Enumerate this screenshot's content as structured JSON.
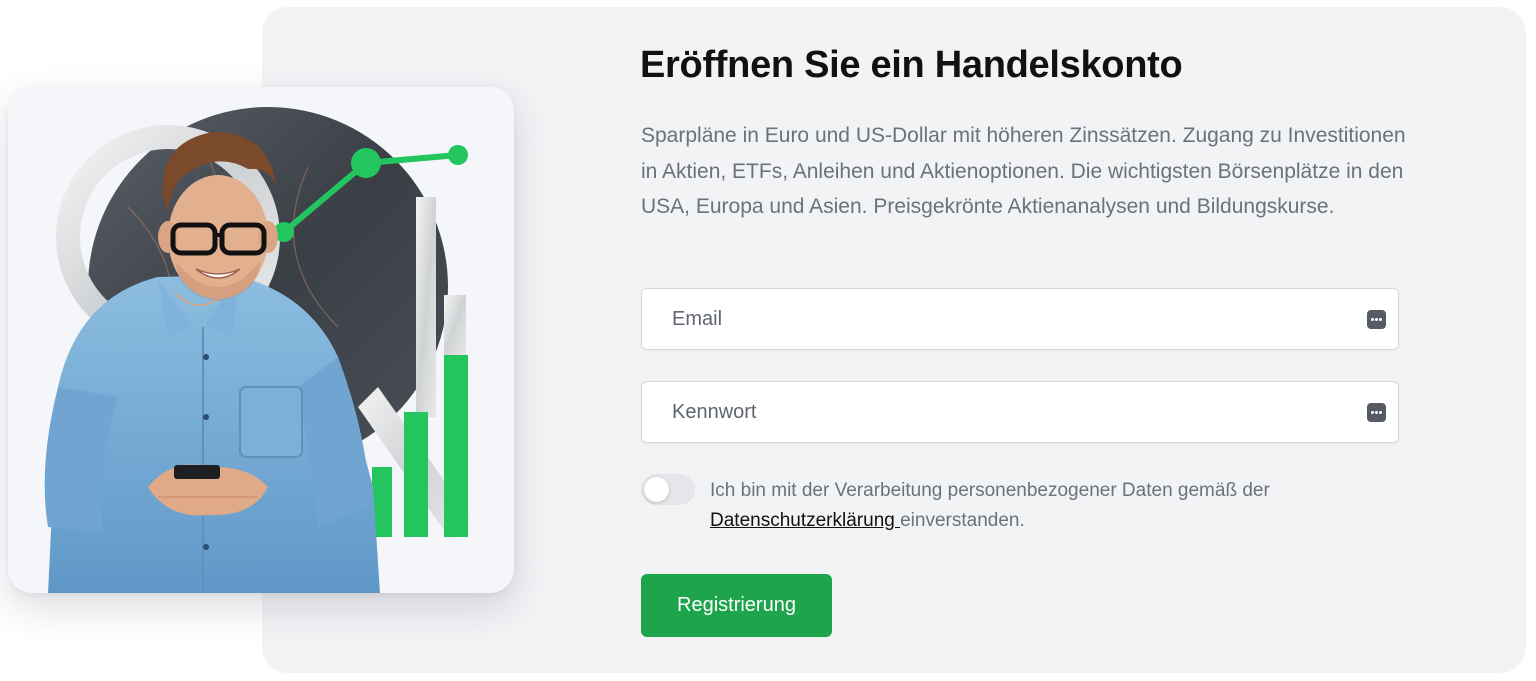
{
  "signup": {
    "title": "Eröffnen Sie ein Handelskonto",
    "description": "Sparpläne in Euro und US-Dollar mit höheren Zinssätzen. Zugang zu Investitionen in Aktien, ETFs, Anleihen und Aktienoptionen. Die wichtigsten Börsenplätze in den USA, Europa und Asien. Preisgekrönte Aktienanalysen und Bildungskurse.",
    "email": {
      "placeholder": "Email",
      "value": "",
      "icon": "password-manager-key-icon"
    },
    "password": {
      "placeholder": "Kennwort",
      "value": "",
      "icon": "password-manager-key-icon"
    },
    "consent": {
      "toggle_on": false,
      "text_before": "Ich bin mit der Verarbeitung personenbezogener Daten gemäß der ",
      "link_text": "Datenschutzerklärung ",
      "text_after": "einverstanden."
    },
    "register_label": "Registrierung"
  },
  "illustration": {
    "description_icon": "man-with-phone-stock-chart-illustration",
    "accent_color": "#22c55e"
  },
  "colors": {
    "panel_bg": "#f2f3f5",
    "button_green": "#1ea44b",
    "text_gray": "#6b727d",
    "title_black": "#111111"
  }
}
